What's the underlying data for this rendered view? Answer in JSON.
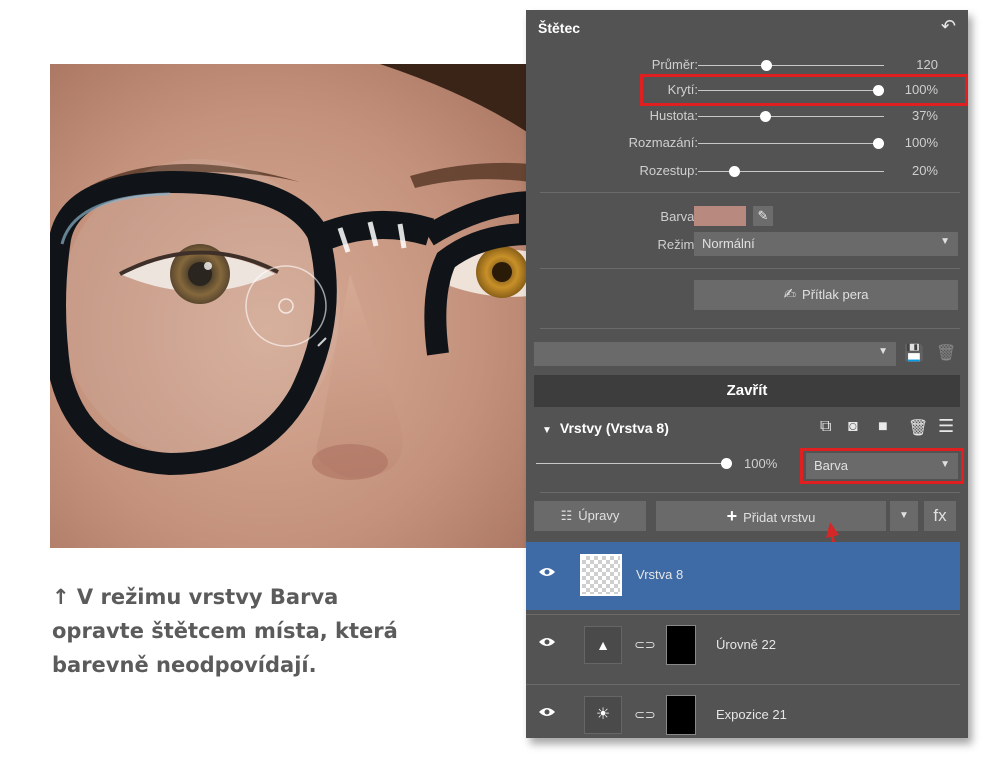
{
  "caption": {
    "line1": "↑ V režimu vrstvy Barva",
    "line2": "opravte štětcem místa, která",
    "line3": "barevně neodpovídají."
  },
  "brush": {
    "title": "Štětec",
    "sliders": [
      {
        "label": "Průměr:",
        "value": "120",
        "level": 0.38
      },
      {
        "label": "Krytí:",
        "value": "100%",
        "level": 1.0
      },
      {
        "label": "Hustota:",
        "value": "37%",
        "level": 0.37
      },
      {
        "label": "Rozmazání:",
        "value": "100%",
        "level": 1.0
      },
      {
        "label": "Rozestup:",
        "value": "20%",
        "level": 0.2
      }
    ],
    "color_label": "Barva:",
    "color_value": "#b88a7f",
    "mode_label": "Režim:",
    "mode_value": "Normální",
    "pressure_button": "Přítlak pera",
    "preset_value": "",
    "close_button": "Zavřít"
  },
  "layers_panel": {
    "title": "Vrstvy (Vrstva 8)",
    "opacity_value": "100%",
    "opacity_level": 1.0,
    "blend_mode": "Barva",
    "adjust_button": "Úpravy",
    "add_layer_button": "Přidat vrstvu",
    "fx_button": "fx",
    "layers": [
      {
        "name": "Vrstva 8",
        "selected": true,
        "icon": "checker-thumbnail"
      },
      {
        "name": "Úrovně 22",
        "selected": false,
        "icon": "levels-icon"
      },
      {
        "name": "Expozice 21",
        "selected": false,
        "icon": "exposure-icon"
      }
    ]
  },
  "colors": {
    "highlight": "#e02020",
    "selected_layer": "#3e6aa5",
    "panel_bg": "#535353"
  }
}
